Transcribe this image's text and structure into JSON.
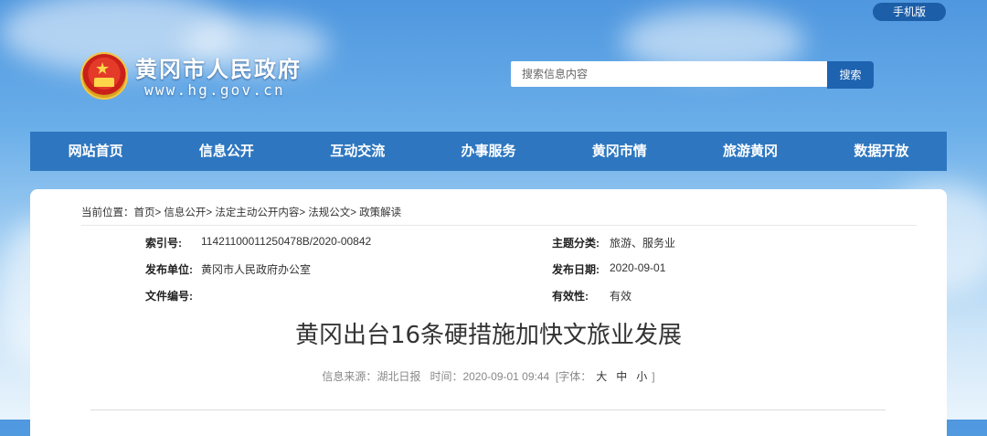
{
  "header": {
    "mobile_label": "手机版",
    "site_title": "黄冈市人民政府",
    "site_url": "www.hg.gov.cn",
    "search_placeholder": "搜索信息内容",
    "search_button": "搜索"
  },
  "nav": {
    "items": [
      {
        "label": "网站首页"
      },
      {
        "label": "信息公开"
      },
      {
        "label": "互动交流"
      },
      {
        "label": "办事服务"
      },
      {
        "label": "黄冈市情"
      },
      {
        "label": "旅游黄冈"
      },
      {
        "label": "数据开放"
      }
    ]
  },
  "breadcrumb": {
    "prefix": "当前位置：",
    "items": [
      "首页",
      "信息公开",
      "法定主动公开内容",
      "法规公文",
      "政策解读"
    ],
    "separator": ">"
  },
  "meta": {
    "index_label": "索引号:",
    "index_value": "11421100011250478B/2020-00842",
    "topic_label": "主题分类:",
    "topic_value": "旅游、服务业",
    "publisher_label": "发布单位:",
    "publisher_value": "黄冈市人民政府办公室",
    "date_label": "发布日期:",
    "date_value": "2020-09-01",
    "docnum_label": "文件编号:",
    "docnum_value": "",
    "validity_label": "有效性:",
    "validity_value": "有效"
  },
  "article": {
    "title": "黄冈出台16条硬措施加快文旅业发展",
    "source_label": "信息来源：",
    "source_value": "湖北日报",
    "time_label": "时间：",
    "time_value": "2020-09-01 09:44",
    "font_label": "[字体：",
    "font_large": "大",
    "font_medium": "中",
    "font_small": "小",
    "font_close": "]"
  },
  "colors": {
    "nav_bg": "#2e77c0",
    "search_button_bg": "#1e63b0",
    "mobile_button_bg": "#1c5ea8"
  }
}
